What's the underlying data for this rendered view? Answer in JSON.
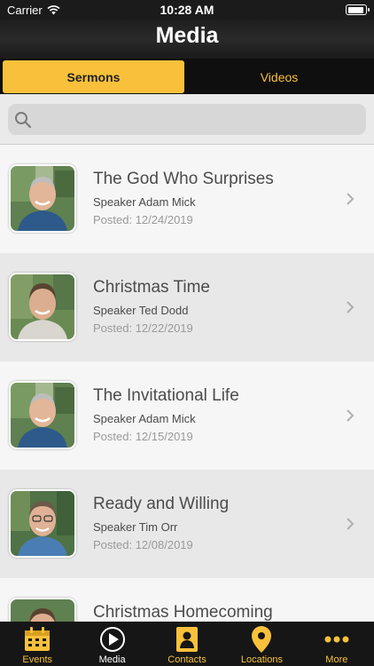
{
  "status_bar": {
    "carrier": "Carrier",
    "time": "10:28 AM",
    "battery_level": 0.95
  },
  "header": {
    "title": "Media"
  },
  "segments": {
    "active": "Sermons",
    "inactive": "Videos"
  },
  "search": {
    "placeholder": "",
    "value": ""
  },
  "sermons": [
    {
      "title": "The God Who Surprises",
      "speaker": "Speaker Adam Mick",
      "posted": "Posted: 12/24/2019"
    },
    {
      "title": "Christmas Time",
      "speaker": "Speaker Ted Dodd",
      "posted": "Posted: 12/22/2019"
    },
    {
      "title": "The Invitational Life",
      "speaker": "Speaker Adam Mick",
      "posted": "Posted: 12/15/2019"
    },
    {
      "title": "Ready and Willing",
      "speaker": "Speaker Tim Orr",
      "posted": "Posted: 12/08/2019"
    },
    {
      "title": "Christmas Homecoming",
      "speaker": "",
      "posted": ""
    }
  ],
  "tabs": [
    {
      "label": "Events",
      "icon": "calendar-icon"
    },
    {
      "label": "Media",
      "icon": "play-icon"
    },
    {
      "label": "Contacts",
      "icon": "contact-card-icon"
    },
    {
      "label": "Locations",
      "icon": "map-pin-icon"
    },
    {
      "label": "More",
      "icon": "more-dots-icon"
    }
  ],
  "colors": {
    "accent": "#f9c13b",
    "nav_bg": "#1b1b1b",
    "row_light": "#f6f6f6",
    "row_dark": "#e8e8e8"
  }
}
